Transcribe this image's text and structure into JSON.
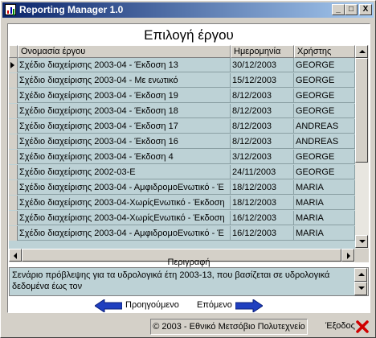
{
  "window": {
    "title": "Reporting Manager 1.0"
  },
  "titlebar_buttons": {
    "minimize": "_",
    "maximize": "□",
    "close": "X"
  },
  "header": {
    "title": "Επιλογή έργου"
  },
  "table": {
    "columns": [
      "Ονομασία έργου",
      "Ημερομηνία",
      "Χρήστης"
    ],
    "rows": [
      [
        "Σχέδιο διαχείρισης 2003-04 - Έκδοση 13",
        "30/12/2003",
        "GEORGE"
      ],
      [
        "Σχέδιο διαχείρισης 2003-04 - Με ενωτικό",
        "15/12/2003",
        "GEORGE"
      ],
      [
        "Σχέδιο διαχείρισης 2003-04 - Έκδοση 19",
        "8/12/2003",
        "GEORGE"
      ],
      [
        "Σχέδιο διαχείρισης 2003-04 - Έκδοση 18",
        "8/12/2003",
        "GEORGE"
      ],
      [
        "Σχέδιο διαχείρισης 2003-04 - Έκδοση 17",
        "8/12/2003",
        "ANDREAS"
      ],
      [
        "Σχέδιο διαχείρισης 2003-04 - Έκδοση 16",
        "8/12/2003",
        "ANDREAS"
      ],
      [
        "Σχέδιο διαχείρισης 2003-04 - Έκδοση 4",
        "3/12/2003",
        "GEORGE"
      ],
      [
        "Σχέδιο διαχείρισης 2002-03-E",
        "24/11/2003",
        "GEORGE"
      ],
      [
        "Σχέδιο διαχείρισης 2003-04 - ΑμφιδρομοΕνωτικό - Έ",
        "18/12/2003",
        "MARIA"
      ],
      [
        "Σχέδιο διαχείρισης 2003-04-ΧωρίςΕνωτικό - Έκδοση",
        "18/12/2003",
        "MARIA"
      ],
      [
        "Σχέδιο διαχείρισης 2003-04-ΧωρίςΕνωτικό - Έκδοση",
        "16/12/2003",
        "MARIA"
      ],
      [
        "Σχέδιο διαχείρισης 2003-04 - ΑμφιδρομοΕνωτικό - Έ",
        "16/12/2003",
        "MARIA"
      ]
    ],
    "selected_row": 0
  },
  "description": {
    "label": "Περιγραφή",
    "text": "Σενάριο πρόβλεψης για τα υδρολογικά έτη 2003-13, που βασίζεται σε υδρολογικά δεδομένα έως τον"
  },
  "navigation": {
    "previous_label": "Προηγούμενο",
    "next_label": "Επόμενο"
  },
  "status": {
    "copyright": "© 2003 - Εθνικό Μετσόβιο Πολυτεχνείο",
    "exit_label": "Έξοδος"
  },
  "colors": {
    "title_gradient_start": "#0a246a",
    "grid_bg": "#bdd2d6",
    "arrow_blue": "#1f3fbf",
    "exit_red": "#d00000"
  }
}
